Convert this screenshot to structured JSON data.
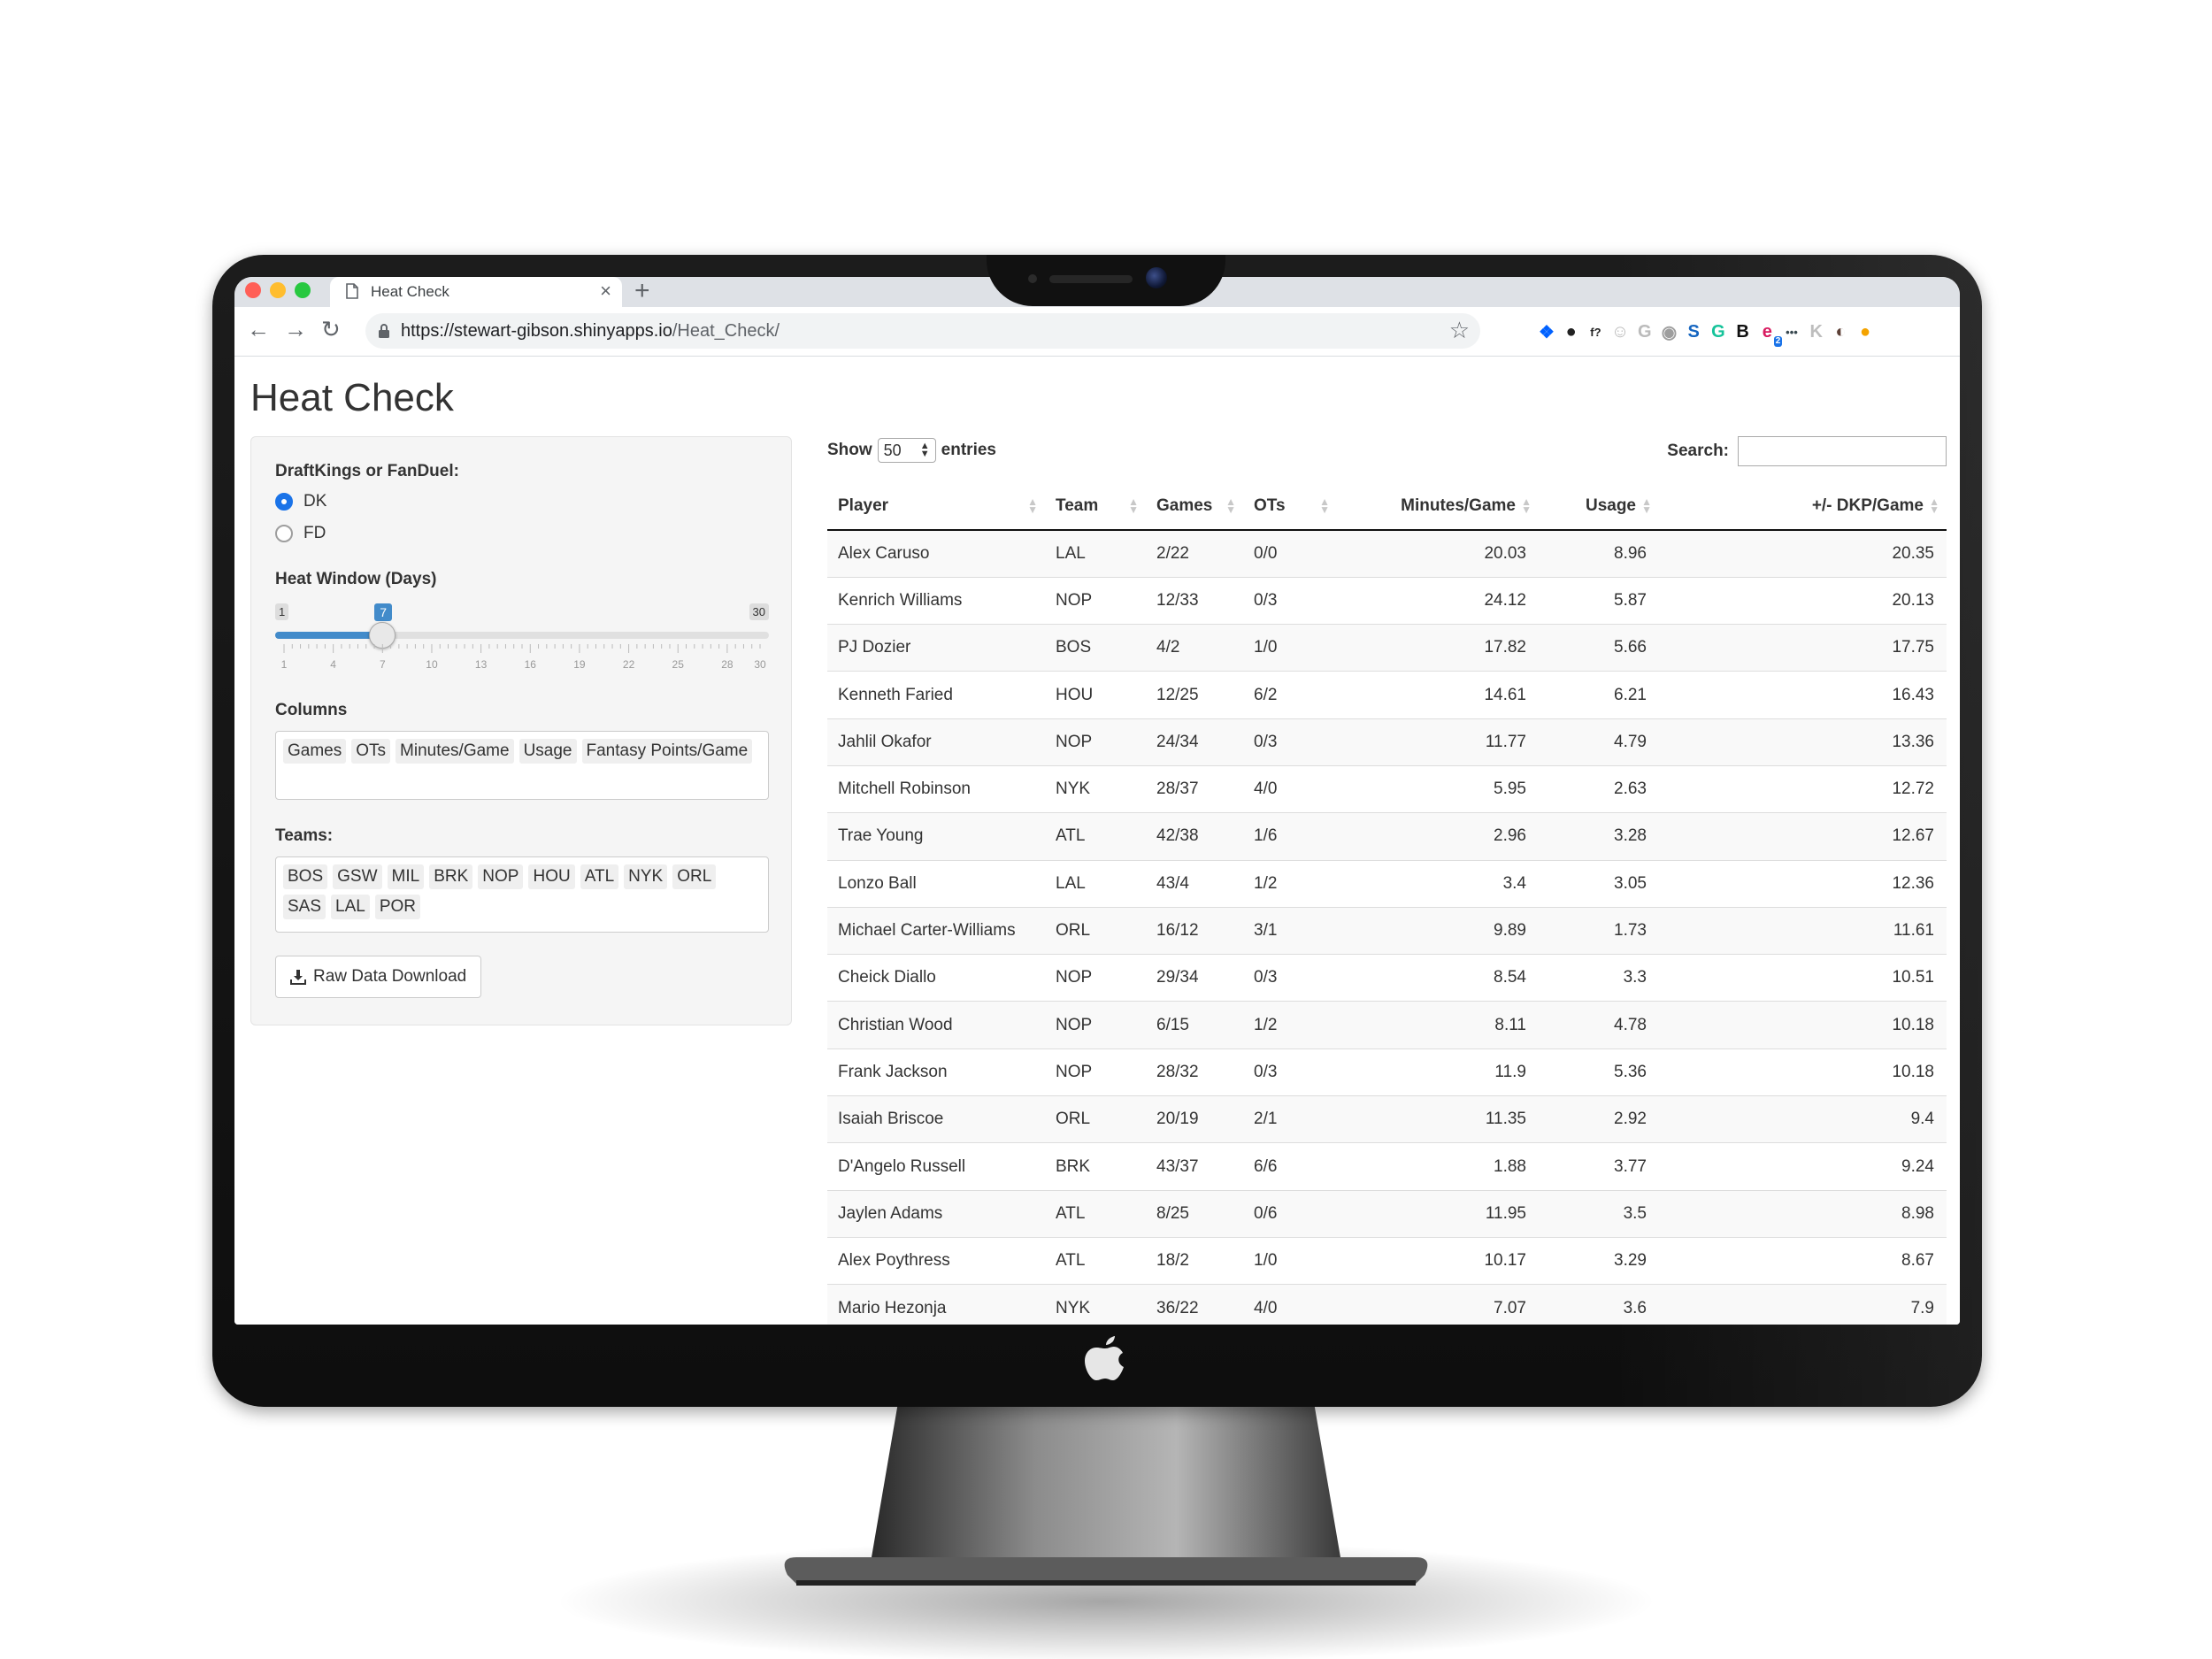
{
  "browser": {
    "tab_title": "Heat Check",
    "tab_close": "×",
    "new_tab": "+",
    "url_main": "https://stewart-gibson.shinyapps.io",
    "url_path": "/Heat_Check/",
    "extensions": [
      {
        "name": "dropbox-extension-icon",
        "glyph": "❖",
        "color": "#0061ff"
      },
      {
        "name": "color-picker-extension-icon",
        "glyph": "●",
        "color": "#222222"
      },
      {
        "name": "function-extension-icon",
        "glyph": "f?",
        "color": "#222222"
      },
      {
        "name": "smiley-extension-icon",
        "glyph": "☺",
        "color": "#bbbbbb"
      },
      {
        "name": "g-extension-icon",
        "glyph": "G",
        "color": "#bbbbbb"
      },
      {
        "name": "camera-extension-icon",
        "glyph": "◉",
        "color": "#9e9e9e"
      },
      {
        "name": "s-extension-icon",
        "glyph": "S",
        "color": "#1565c0"
      },
      {
        "name": "grammarly-extension-icon",
        "glyph": "G",
        "color": "#15c39a"
      },
      {
        "name": "b-extension-icon",
        "glyph": "B",
        "color": "#111111"
      },
      {
        "name": "badge-extension-icon",
        "glyph": "e",
        "color": "#d81b60",
        "badge": "2"
      },
      {
        "name": "dots-extension-icon",
        "glyph": "•••",
        "color": "#37474f"
      },
      {
        "name": "k-extension-icon",
        "glyph": "K",
        "color": "#bdbdbd"
      },
      {
        "name": "profile-avatar-icon",
        "glyph": "◐",
        "color": "#5d4037"
      },
      {
        "name": "update-extension-icon",
        "glyph": "●",
        "color": "#f4a300"
      }
    ]
  },
  "app": {
    "title": "Heat Check",
    "site_toggle": {
      "label": "DraftKings or FanDuel:",
      "options": [
        "DK",
        "FD"
      ],
      "selected": "DK"
    },
    "heat_window": {
      "label": "Heat Window (Days)",
      "min": 1,
      "max": 30,
      "value": 7,
      "min_label": "1",
      "max_label": "30",
      "value_label": "7",
      "tick_labels": [
        "1",
        "4",
        "7",
        "10",
        "13",
        "16",
        "19",
        "22",
        "25",
        "28",
        "30"
      ]
    },
    "columns": {
      "label": "Columns",
      "selected": [
        "Games",
        "OTs",
        "Minutes/Game",
        "Usage",
        "Fantasy Points/Game"
      ]
    },
    "teams": {
      "label": "Teams:",
      "selected": [
        "BOS",
        "GSW",
        "MIL",
        "BRK",
        "NOP",
        "HOU",
        "ATL",
        "NYK",
        "ORL",
        "SAS",
        "LAL",
        "POR"
      ]
    },
    "download_label": "Raw Data Download"
  },
  "table": {
    "show_label": "Show",
    "entries_label": "entries",
    "page_length": "50",
    "search_label": "Search:",
    "search_value": "",
    "headers": [
      "Player",
      "Team",
      "Games",
      "OTs",
      "Minutes/Game",
      "Usage",
      "+/- DKP/Game"
    ],
    "rows": [
      [
        "Alex Caruso",
        "LAL",
        "2/22",
        "0/0",
        "20.03",
        "8.96",
        "20.35"
      ],
      [
        "Kenrich Williams",
        "NOP",
        "12/33",
        "0/3",
        "24.12",
        "5.87",
        "20.13"
      ],
      [
        "PJ Dozier",
        "BOS",
        "4/2",
        "1/0",
        "17.82",
        "5.66",
        "17.75"
      ],
      [
        "Kenneth Faried",
        "HOU",
        "12/25",
        "6/2",
        "14.61",
        "6.21",
        "16.43"
      ],
      [
        "Jahlil Okafor",
        "NOP",
        "24/34",
        "0/3",
        "11.77",
        "4.79",
        "13.36"
      ],
      [
        "Mitchell Robinson",
        "NYK",
        "28/37",
        "4/0",
        "5.95",
        "2.63",
        "12.72"
      ],
      [
        "Trae Young",
        "ATL",
        "42/38",
        "1/6",
        "2.96",
        "3.28",
        "12.67"
      ],
      [
        "Lonzo Ball",
        "LAL",
        "43/4",
        "1/2",
        "3.4",
        "3.05",
        "12.36"
      ],
      [
        "Michael Carter-Williams",
        "ORL",
        "16/12",
        "3/1",
        "9.89",
        "1.73",
        "11.61"
      ],
      [
        "Cheick Diallo",
        "NOP",
        "29/34",
        "0/3",
        "8.54",
        "3.3",
        "10.51"
      ],
      [
        "Christian Wood",
        "NOP",
        "6/15",
        "1/2",
        "8.11",
        "4.78",
        "10.18"
      ],
      [
        "Frank Jackson",
        "NOP",
        "28/32",
        "0/3",
        "11.9",
        "5.36",
        "10.18"
      ],
      [
        "Isaiah Briscoe",
        "ORL",
        "20/19",
        "2/1",
        "11.35",
        "2.92",
        "9.4"
      ],
      [
        "D'Angelo Russell",
        "BRK",
        "43/37",
        "6/6",
        "1.88",
        "3.77",
        "9.24"
      ],
      [
        "Jaylen Adams",
        "ATL",
        "8/25",
        "0/6",
        "11.95",
        "3.5",
        "8.98"
      ],
      [
        "Alex Poythress",
        "ATL",
        "18/2",
        "1/0",
        "10.17",
        "3.29",
        "8.67"
      ],
      [
        "Mario Hezonja",
        "NYK",
        "36/22",
        "4/0",
        "7.07",
        "3.6",
        "7.9"
      ]
    ]
  }
}
